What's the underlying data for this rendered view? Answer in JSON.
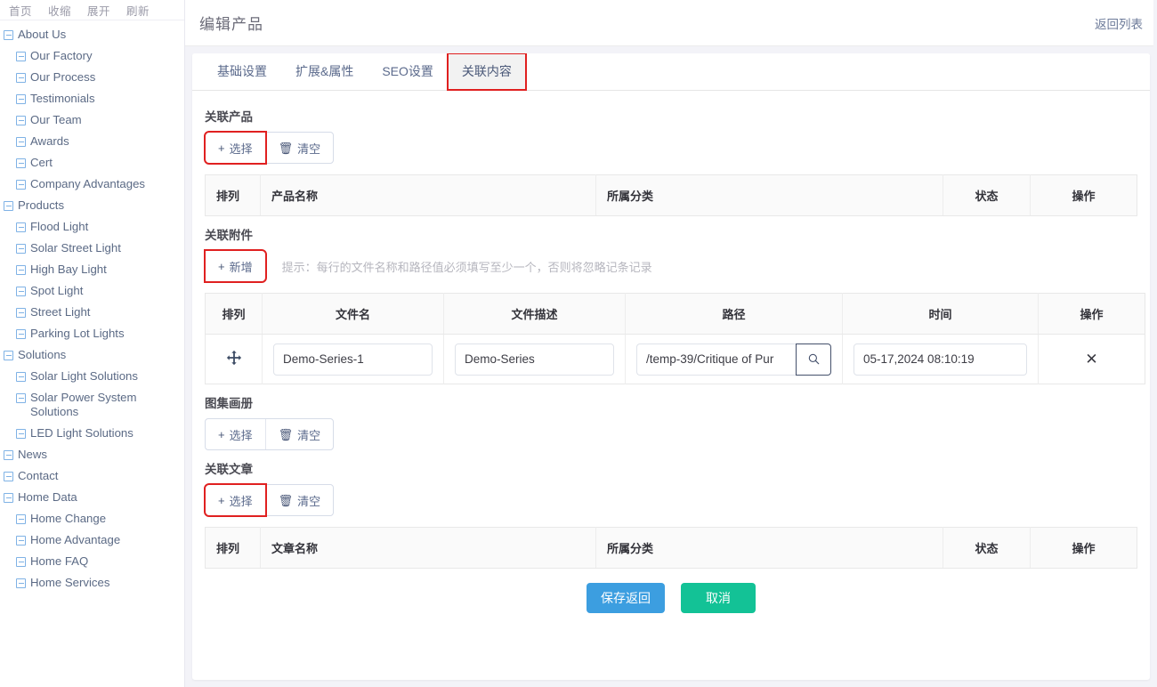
{
  "sidebar": {
    "topnav": [
      "首页",
      "收缩",
      "展开",
      "刷新"
    ],
    "tree": [
      {
        "label": "About Us",
        "level": 1
      },
      {
        "label": "Our Factory",
        "level": 2
      },
      {
        "label": "Our Process",
        "level": 2
      },
      {
        "label": "Testimonials",
        "level": 2
      },
      {
        "label": "Our Team",
        "level": 2
      },
      {
        "label": "Awards",
        "level": 2
      },
      {
        "label": "Cert",
        "level": 2
      },
      {
        "label": "Company Advantages",
        "level": 2
      },
      {
        "label": "Products",
        "level": 1
      },
      {
        "label": "Flood Light",
        "level": 2
      },
      {
        "label": "Solar Street Light",
        "level": 2
      },
      {
        "label": "High Bay Light",
        "level": 2
      },
      {
        "label": "Spot Light",
        "level": 2
      },
      {
        "label": "Street Light",
        "level": 2
      },
      {
        "label": "Parking Lot Lights",
        "level": 2
      },
      {
        "label": "Solutions",
        "level": 1
      },
      {
        "label": "Solar Light Solutions",
        "level": 2
      },
      {
        "label": "Solar Power System Solutions",
        "level": 2
      },
      {
        "label": "LED Light Solutions",
        "level": 2
      },
      {
        "label": "News",
        "level": 1
      },
      {
        "label": "Contact",
        "level": 1
      },
      {
        "label": "Home Data",
        "level": 1
      },
      {
        "label": "Home Change",
        "level": 2
      },
      {
        "label": "Home Advantage",
        "level": 2
      },
      {
        "label": "Home FAQ",
        "level": 2
      },
      {
        "label": "Home Services",
        "level": 2
      }
    ]
  },
  "header": {
    "title": "编辑产品",
    "back_link": "返回列表"
  },
  "tabs": [
    {
      "label": "基础设置",
      "active": false
    },
    {
      "label": "扩展&属性",
      "active": false
    },
    {
      "label": "SEO设置",
      "active": false
    },
    {
      "label": "关联内容",
      "active": true
    }
  ],
  "related_products": {
    "section_title": "关联产品",
    "select_label": "选择",
    "clear_label": "清空",
    "plus_icon": "plus-icon",
    "trash_icon": "trash-icon",
    "columns": [
      "排列",
      "产品名称",
      "所属分类",
      "状态",
      "操作"
    ],
    "rows": []
  },
  "attachments": {
    "section_title": "关联附件",
    "add_label": "新增",
    "hint": "提示：每行的文件名称和路径值必须填写至少一个，否则将忽略记条记录",
    "columns": [
      "排列",
      "文件名",
      "文件描述",
      "路径",
      "时间",
      "操作"
    ],
    "rows": [
      {
        "drag_icon": "move-icon",
        "file_name": "Demo-Series-1",
        "file_desc": "Demo-Series",
        "path": "/temp-39/Critique of Pur",
        "search_icon": "search-icon",
        "time": "05-17,2024 08:10:19",
        "delete_icon": "close-icon"
      }
    ]
  },
  "gallery": {
    "section_title": "图集画册",
    "select_label": "选择",
    "clear_label": "清空"
  },
  "related_articles": {
    "section_title": "关联文章",
    "select_label": "选择",
    "clear_label": "清空",
    "columns": [
      "排列",
      "文章名称",
      "所属分类",
      "状态",
      "操作"
    ],
    "rows": []
  },
  "footer": {
    "save_label": "保存返回",
    "cancel_label": "取消"
  },
  "colors": {
    "highlight": "#e02020",
    "primary": "#3c9ee0",
    "cancel": "#13c296",
    "tree_icon": "#7fb2e5"
  }
}
